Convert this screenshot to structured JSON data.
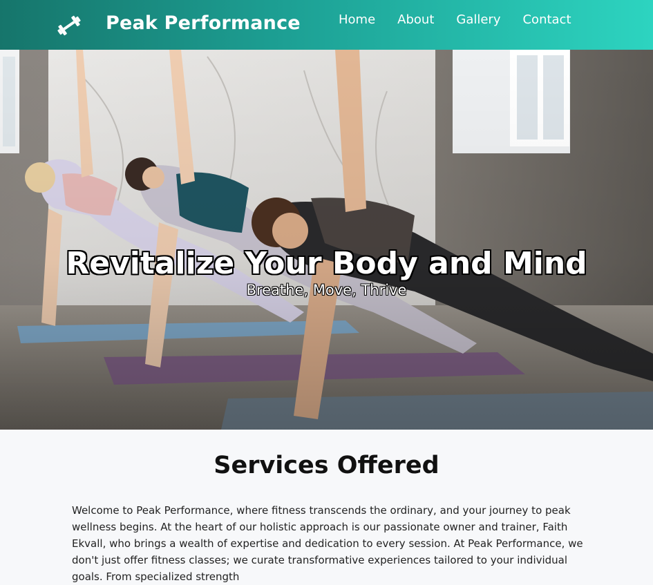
{
  "header": {
    "logo_icon": "dumbbell-icon",
    "brand": "Peak Performance",
    "nav": [
      {
        "label": "Home"
      },
      {
        "label": "About"
      },
      {
        "label": "Gallery"
      },
      {
        "label": "Contact"
      }
    ],
    "colors": {
      "gradient_start": "#16756b",
      "gradient_end": "#2dd4c0"
    }
  },
  "hero": {
    "title": "Revitalize Your Body and Mind",
    "subtitle": "Breathe, Move, Thrive"
  },
  "services": {
    "title": "Services Offered",
    "text": "Welcome to Peak Performance, where fitness transcends the ordinary, and your journey to peak wellness begins. At the heart of our holistic approach is our passionate owner and trainer, Faith Ekvall, who brings a wealth of expertise and dedication to every session. At Peak Performance, we don't just offer fitness classes; we curate transformative experiences tailored to your individual goals. From specialized strength"
  }
}
